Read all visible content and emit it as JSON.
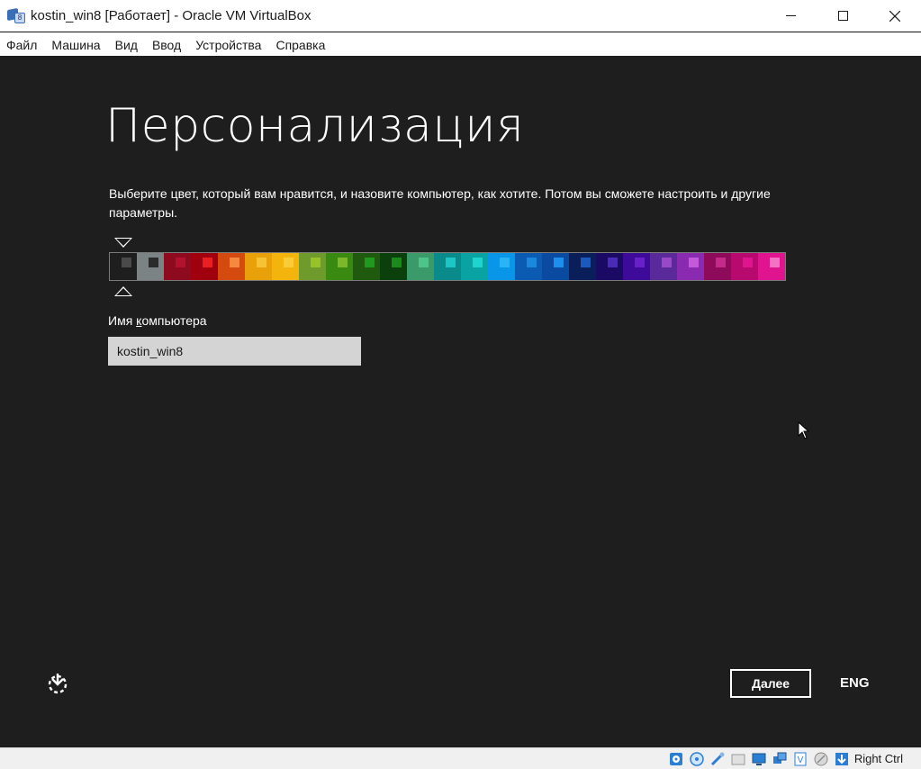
{
  "window": {
    "title": "kostin_win8 [Работает] - Oracle VM VirtualBox",
    "app_icon": "virtualbox-icon",
    "controls": [
      "minimize",
      "maximize",
      "close"
    ]
  },
  "menubar": {
    "items": [
      "Файл",
      "Машина",
      "Вид",
      "Ввод",
      "Устройства",
      "Справка"
    ]
  },
  "setup": {
    "title": "Персонализация",
    "description": "Выберите цвет, который вам нравится, и назовите компьютер, как хотите. Потом вы сможете настроить и другие параметры.",
    "computer_name_label_before": "Имя ",
    "computer_name_label_mnemonic": "к",
    "computer_name_label_after": "омпьютера",
    "computer_name_value": "kostin_win8",
    "next_label_mnemonic": "Д",
    "next_label_rest": "алее",
    "language": "ENG",
    "selected_color_index": 0,
    "colors": [
      {
        "bg": "#1e1e1e",
        "accent": "#4a4a4a"
      },
      {
        "bg": "#7c8385",
        "accent": "#2b2b2b"
      },
      {
        "bg": "#8e0a1e",
        "accent": "#b3122f"
      },
      {
        "bg": "#a0000e",
        "accent": "#ea1f1f"
      },
      {
        "bg": "#d44a0f",
        "accent": "#f58a3e"
      },
      {
        "bg": "#e8a10a",
        "accent": "#f5c436"
      },
      {
        "bg": "#f3b40e",
        "accent": "#f9cc3a"
      },
      {
        "bg": "#6f9a2c",
        "accent": "#98c22a"
      },
      {
        "bg": "#3a8a12",
        "accent": "#7cb82a"
      },
      {
        "bg": "#1f5a0e",
        "accent": "#1e9a1e"
      },
      {
        "bg": "#0b3f0b",
        "accent": "#1a8a1a"
      },
      {
        "bg": "#3a9a6a",
        "accent": "#4ec48a"
      },
      {
        "bg": "#0a8a8a",
        "accent": "#1cc6c6"
      },
      {
        "bg": "#09a3a3",
        "accent": "#1ed4cf"
      },
      {
        "bg": "#0a96e8",
        "accent": "#2ab4f5"
      },
      {
        "bg": "#0b5bb3",
        "accent": "#1a88dc"
      },
      {
        "bg": "#0a4aa0",
        "accent": "#1c90ec"
      },
      {
        "bg": "#0a1e5a",
        "accent": "#1a5ac0"
      },
      {
        "bg": "#1a0a64",
        "accent": "#4a2ab8"
      },
      {
        "bg": "#3e0a9a",
        "accent": "#6a20c8"
      },
      {
        "bg": "#5a2a9a",
        "accent": "#9a48c8"
      },
      {
        "bg": "#8a2ab0",
        "accent": "#c45ad8"
      },
      {
        "bg": "#8e0a5a",
        "accent": "#c42a8a"
      },
      {
        "bg": "#b80a6e",
        "accent": "#e0148e"
      },
      {
        "bg": "#e0148e",
        "accent": "#f472c2"
      }
    ]
  },
  "statusbar": {
    "icons": [
      "hard-disk-icon",
      "optical-drive-icon",
      "usb-icon",
      "shared-folders-icon",
      "display-icon",
      "network-icon",
      "virtualization-icon",
      "mouse-integration-icon",
      "keyboard-capture-icon"
    ],
    "host_key": "Right Ctrl"
  }
}
